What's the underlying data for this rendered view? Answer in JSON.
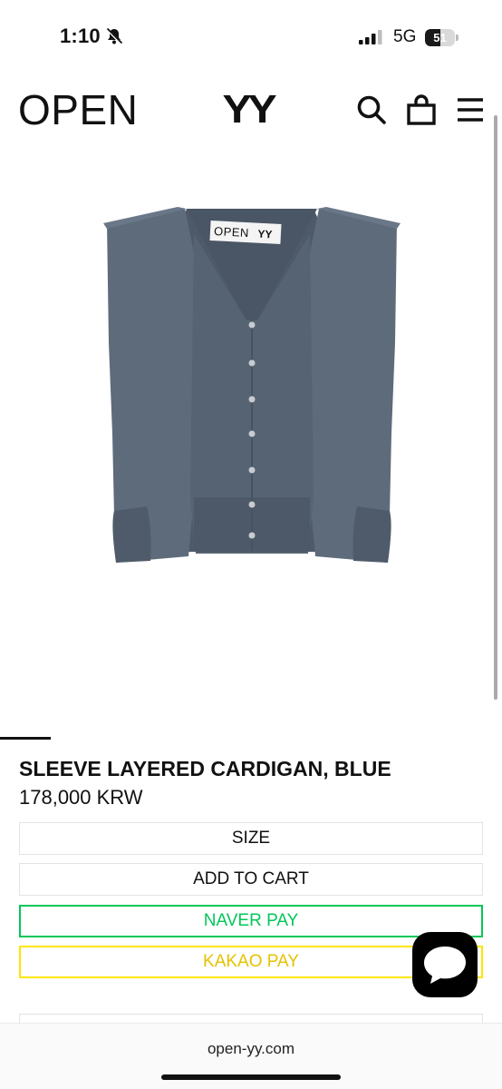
{
  "status_bar": {
    "time": "1:10",
    "network": "5G",
    "battery_level": "51",
    "battery_fraction": 0.51
  },
  "header": {
    "logo_left": "OPEN",
    "logo_right": "YY",
    "icons": [
      "search-icon",
      "shopping-bag-icon",
      "menu-icon"
    ]
  },
  "product_image": {
    "label_left": "OPEN",
    "label_right": "YY",
    "color": "#5b6878"
  },
  "product": {
    "title": "SLEEVE LAYERED CARDIGAN, BLUE",
    "price": "178,000 KRW"
  },
  "buttons": {
    "size": "SIZE",
    "add_to_cart": "ADD TO CART",
    "naver_pay": "NAVER PAY",
    "kakao_pay": "KAKAO PAY"
  },
  "colors": {
    "naver": "#03c75a",
    "kakao": "#fee500"
  },
  "browser": {
    "url": "open-yy.com"
  }
}
